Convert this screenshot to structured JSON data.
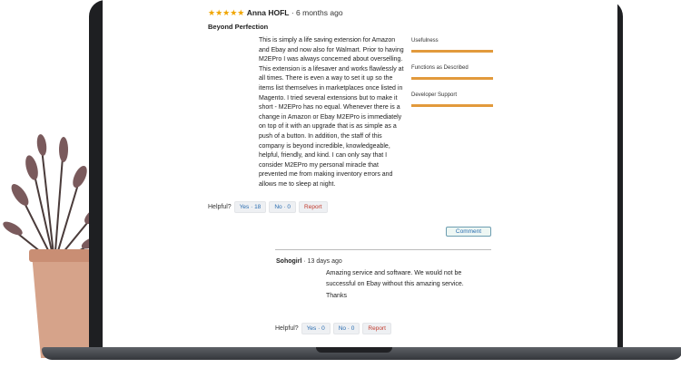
{
  "review": {
    "stars": "★★★★★",
    "reviewer": "Anna HOFL",
    "time": "· 6 months ago",
    "title": "Beyond Perfection",
    "body": "This is simply a life saving extension for Amazon and Ebay and now also for Walmart. Prior to having M2EPro I was always concerned about overselling. This extension is a lifesaver and works flawlessly at all times. There is even a way to set it up so the items list themselves in marketplaces once listed in Magento. I tried several extensions but to make it short - M2EPro has no equal. Whenever there is a change in Amazon or Ebay M2EPro is immediately on top of it with an upgrade that is as simple as a push of a button. In addition, the staff of this company is beyond incredible, knowledgeable, helpful, friendly, and kind. I can only say that I consider M2EPro my personal miracle that prevented me from making inventory errors and allows me to sleep at night.",
    "ratings": [
      {
        "label": "Usefulness",
        "value": 1.0
      },
      {
        "label": "Functions as Described",
        "value": 1.0
      },
      {
        "label": "Developer Support",
        "value": 1.0
      }
    ],
    "helpful": {
      "label": "Helpful?",
      "yes": "Yes · 18",
      "no": "No · 0",
      "report": "Report"
    }
  },
  "comment_button": "Comment",
  "reply": {
    "author": "Sohogirl",
    "time": "· 13 days ago",
    "text": "Amazing service and software. We would not be successful on Ebay without this amazing service.",
    "thanks": "Thanks",
    "helpful": {
      "label": "Helpful?",
      "yes": "Yes · 0",
      "no": "No · 0",
      "report": "Report"
    }
  },
  "colors": {
    "accent": "#e29a3c",
    "link": "#2a6db0",
    "report": "#c0392b",
    "laptop": "#1e1f22"
  }
}
